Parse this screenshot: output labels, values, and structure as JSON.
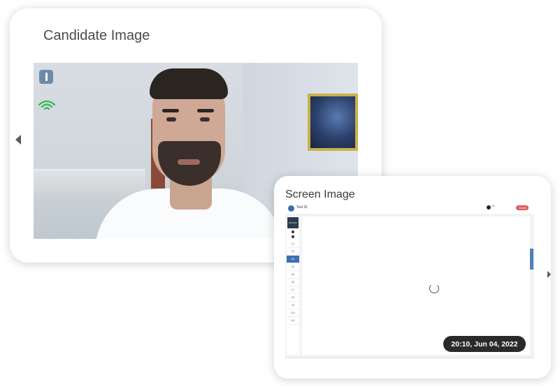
{
  "candidate_panel": {
    "title": "Candidate Image",
    "connection_status": "wifi-strong"
  },
  "screen_panel": {
    "title": "Screen Image",
    "timestamp": "20:10, Jun 04, 2022",
    "captured_screen": {
      "test_label": "Test 31",
      "submit_label": "Submit",
      "user_name": "ID",
      "timer_label": "00:44:01",
      "question_items": [
        "Q1",
        "Q2",
        "Q3",
        "Q4",
        "Q5",
        "Q6",
        "Q7",
        "Q8",
        "Q9",
        "Q10",
        "Q11"
      ],
      "active_question_index": 2
    }
  },
  "icons": {
    "prev": "chevron-left-icon",
    "next": "chevron-right-icon",
    "info": "info-icon",
    "wifi": "wifi-icon",
    "loading": "spinner-icon"
  },
  "colors": {
    "accent": "#3b6fb6",
    "submit": "#e05a5a",
    "timestamp_bg": "#2a2a2a",
    "wifi": "#2db84d"
  }
}
